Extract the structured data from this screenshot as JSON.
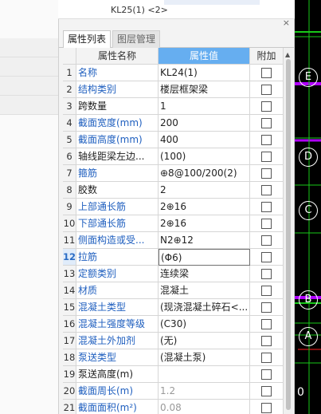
{
  "tree": {
    "visible_item": "KL25(1) <2>"
  },
  "panel": {
    "close_glyph": "×",
    "tabs": [
      {
        "label": "属性列表",
        "active": true
      },
      {
        "label": "图层管理",
        "active": false
      }
    ],
    "headers": {
      "name": "属性名称",
      "value": "属性值",
      "add": "附加"
    },
    "rows": [
      {
        "idx": "1",
        "name": "名称",
        "value": "KL24(1)",
        "blue": true,
        "gray": false
      },
      {
        "idx": "2",
        "name": "结构类别",
        "value": "楼层框架梁",
        "blue": true,
        "gray": false
      },
      {
        "idx": "3",
        "name": "跨数量",
        "value": "1",
        "blue": false,
        "gray": false
      },
      {
        "idx": "4",
        "name": "截面宽度(mm)",
        "value": "200",
        "blue": true,
        "gray": false
      },
      {
        "idx": "5",
        "name": "截面高度(mm)",
        "value": "400",
        "blue": true,
        "gray": false
      },
      {
        "idx": "6",
        "name": "轴线距梁左边...",
        "value": "(100)",
        "blue": false,
        "gray": false
      },
      {
        "idx": "7",
        "name": "箍筋",
        "value": "⊕8@100/200(2)",
        "blue": true,
        "gray": false
      },
      {
        "idx": "8",
        "name": "胶数",
        "value": "2",
        "blue": false,
        "gray": false
      },
      {
        "idx": "9",
        "name": "上部通长筋",
        "value": "2⊕16",
        "blue": true,
        "gray": false
      },
      {
        "idx": "10",
        "name": "下部通长筋",
        "value": "2⊕16",
        "blue": true,
        "gray": false
      },
      {
        "idx": "11",
        "name": "侧面构造或受...",
        "value": "N2⊕12",
        "blue": true,
        "gray": false
      },
      {
        "idx": "12",
        "name": "拉筋",
        "value": "(Φ6)",
        "blue": true,
        "gray": false,
        "selected": true
      },
      {
        "idx": "13",
        "name": "定额类别",
        "value": "连续梁",
        "blue": true,
        "gray": false
      },
      {
        "idx": "14",
        "name": "材质",
        "value": "混凝土",
        "blue": true,
        "gray": false
      },
      {
        "idx": "15",
        "name": "混凝土类型",
        "value": "(现浇混凝土碎石<...",
        "blue": true,
        "gray": false
      },
      {
        "idx": "16",
        "name": "混凝土强度等级",
        "value": "(C30)",
        "blue": true,
        "gray": false
      },
      {
        "idx": "17",
        "name": "混凝土外加剂",
        "value": "(无)",
        "blue": true,
        "gray": false
      },
      {
        "idx": "18",
        "name": "泵送类型",
        "value": "(混凝土泵)",
        "blue": true,
        "gray": false
      },
      {
        "idx": "19",
        "name": "泵送高度(m)",
        "value": "",
        "blue": false,
        "gray": false
      },
      {
        "idx": "20",
        "name": "截面周长(m)",
        "value": "1.2",
        "blue": true,
        "gray": true
      },
      {
        "idx": "21",
        "name": "截面面积(m²)",
        "value": "0.08",
        "blue": true,
        "gray": true
      }
    ]
  },
  "canvas": {
    "axis_labels": [
      "E",
      "D",
      "C",
      "B",
      "A"
    ],
    "bottom_text": "0",
    "colors": {
      "background": "#000000",
      "green": "#19c819",
      "purple": "#b000ff",
      "red": "#ff2020"
    }
  }
}
